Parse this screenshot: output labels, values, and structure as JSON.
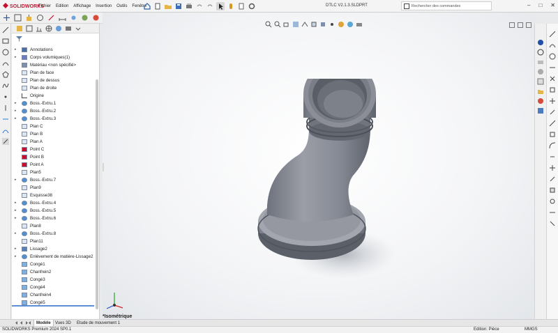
{
  "app": {
    "brand": "SOLIDWORKS",
    "document_title": "DTLC V2.1.3.SLDPRT"
  },
  "menu": [
    "Fichier",
    "Edition",
    "Affichage",
    "Insertion",
    "Outils",
    "Fenêtre"
  ],
  "search": {
    "placeholder": "Rechercher des commandes"
  },
  "feature_tree": {
    "items": [
      {
        "label": "Annotations",
        "icon": "annotations-icon",
        "expandable": true
      },
      {
        "label": "Corps volumiques(1)",
        "icon": "solid-bodies-icon",
        "expandable": true
      },
      {
        "label": "Matériau <non spécifié>",
        "icon": "material-icon",
        "expandable": false
      },
      {
        "label": "Plan de face",
        "icon": "plane-icon",
        "expandable": false
      },
      {
        "label": "Plan de dessus",
        "icon": "plane-icon",
        "expandable": false
      },
      {
        "label": "Plan de droite",
        "icon": "plane-icon",
        "expandable": false
      },
      {
        "label": "Origine",
        "icon": "origin-icon",
        "expandable": false
      },
      {
        "label": "Boss.-Extru.1",
        "icon": "extrude-icon",
        "expandable": true
      },
      {
        "label": "Boss.-Extru.2",
        "icon": "extrude-icon",
        "expandable": true
      },
      {
        "label": "Boss.-Extru.3",
        "icon": "extrude-icon",
        "expandable": true
      },
      {
        "label": "Plan C",
        "icon": "plane-icon",
        "expandable": false
      },
      {
        "label": "Plan B",
        "icon": "plane-icon",
        "expandable": false
      },
      {
        "label": "Plan A",
        "icon": "plane-icon",
        "expandable": false
      },
      {
        "label": "Point C",
        "icon": "point-icon",
        "expandable": false
      },
      {
        "label": "Point B",
        "icon": "point-icon",
        "expandable": false
      },
      {
        "label": "Point A",
        "icon": "point-icon",
        "expandable": false
      },
      {
        "label": "Plan5",
        "icon": "plane-icon",
        "expandable": false
      },
      {
        "label": "Boss.-Extru.7",
        "icon": "extrude-icon",
        "expandable": true
      },
      {
        "label": "Plan9",
        "icon": "plane-icon",
        "expandable": false
      },
      {
        "label": "Esquisse38",
        "icon": "sketch-icon",
        "expandable": false
      },
      {
        "label": "Boss.-Extru.4",
        "icon": "extrude-icon",
        "expandable": true
      },
      {
        "label": "Boss.-Extru.5",
        "icon": "extrude-icon",
        "expandable": true
      },
      {
        "label": "Boss.-Extru.6",
        "icon": "extrude-icon",
        "expandable": true
      },
      {
        "label": "Plan8",
        "icon": "plane-icon",
        "expandable": false
      },
      {
        "label": "Boss.-Extru.8",
        "icon": "extrude-icon",
        "expandable": true
      },
      {
        "label": "Plan11",
        "icon": "plane-icon",
        "expandable": false
      },
      {
        "label": "Lissage2",
        "icon": "loft-icon",
        "expandable": true
      },
      {
        "label": "Enlèvement de matière-Lissage2",
        "icon": "cut-loft-icon",
        "expandable": true
      },
      {
        "label": "Congé1",
        "icon": "fillet-icon",
        "expandable": false
      },
      {
        "label": "Chanfrein2",
        "icon": "chamfer-icon",
        "expandable": false
      },
      {
        "label": "Congé3",
        "icon": "fillet-icon",
        "expandable": false
      },
      {
        "label": "Congé4",
        "icon": "fillet-icon",
        "expandable": false
      },
      {
        "label": "Chanfrein4",
        "icon": "chamfer-icon",
        "expandable": false
      },
      {
        "label": "Congé5",
        "icon": "fillet-icon",
        "expandable": false
      }
    ]
  },
  "viewport": {
    "view_name": "*Isométrique"
  },
  "bottom_tabs": [
    "Modèle",
    "Vues 3D",
    "Etude de mouvement 1"
  ],
  "status": {
    "left": "SOLIDWORKS Premium 2024 SP0.1",
    "edition": "Edition: Pièce",
    "units": "MMGS"
  },
  "colors": {
    "brand_red": "#c8102e",
    "part_gray": "#8d9099",
    "viewport_bg": "#f4f5f7"
  }
}
